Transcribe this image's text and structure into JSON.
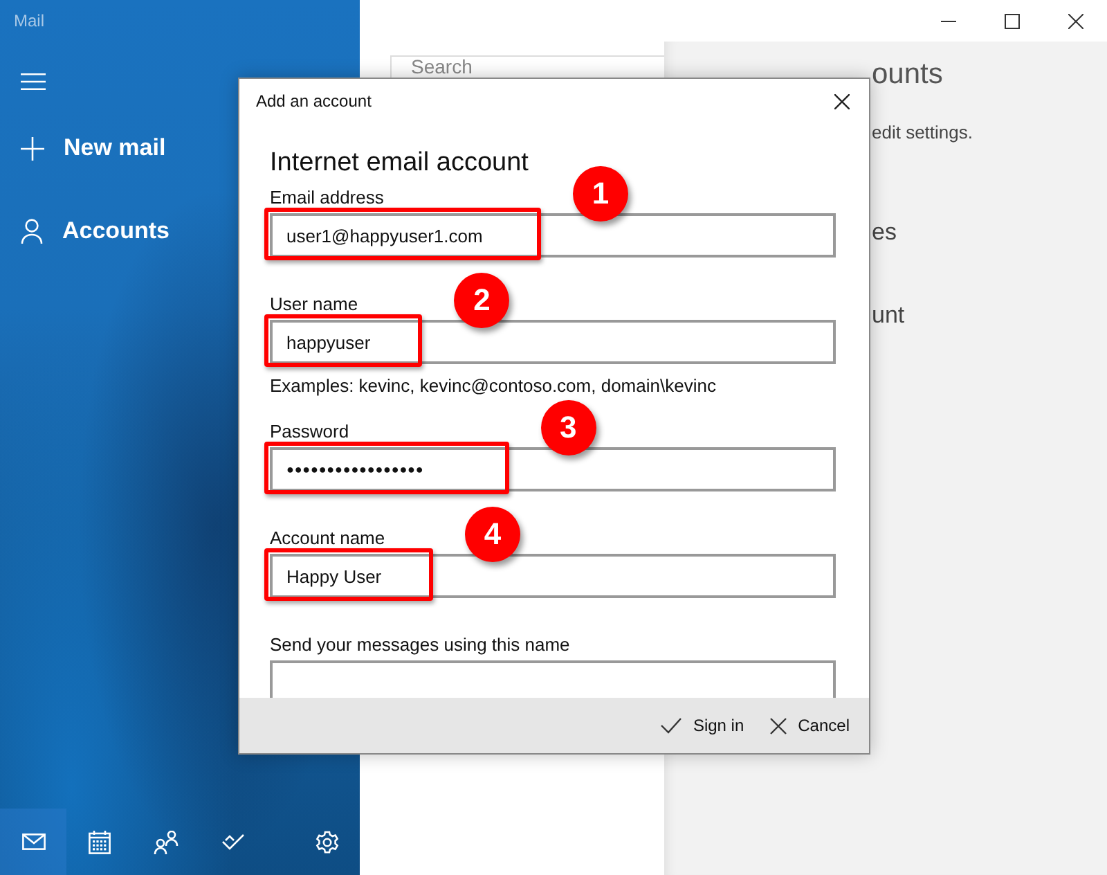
{
  "window": {
    "title": "Mail"
  },
  "sidebar": {
    "items": [
      {
        "kind": "new",
        "label": "New mail"
      },
      {
        "kind": "accounts",
        "label": "Accounts"
      }
    ],
    "bottom_nav": [
      {
        "kind": "mail",
        "selected": true
      },
      {
        "kind": "calendar",
        "selected": false
      },
      {
        "kind": "people",
        "selected": false
      },
      {
        "kind": "todo",
        "selected": false
      },
      {
        "kind": "settings",
        "selected": false
      }
    ]
  },
  "search": {
    "placeholder": "Search"
  },
  "right_pane": {
    "title": "ounts",
    "texts": [
      "edit settings.",
      "es",
      "unt"
    ]
  },
  "dialog": {
    "title": "Add an account",
    "heading": "Internet email account",
    "fields": [
      {
        "label": "Email address",
        "value": "user1@happyuser1.com",
        "marker": "1"
      },
      {
        "label": "User name",
        "value": "happyuser",
        "marker": "2",
        "hint": "Examples: kevinc, kevinc@contoso.com, domain\\kevinc"
      },
      {
        "label": "Password",
        "value": "●●●●●●●●●●●●●●●●●",
        "marker": "3"
      },
      {
        "label": "Account name",
        "value": "Happy User",
        "marker": "4"
      },
      {
        "label": "Send your messages using this name"
      }
    ],
    "buttons": [
      {
        "kind": "confirm",
        "label": "Sign in"
      },
      {
        "kind": "cancel",
        "label": "Cancel"
      }
    ]
  }
}
